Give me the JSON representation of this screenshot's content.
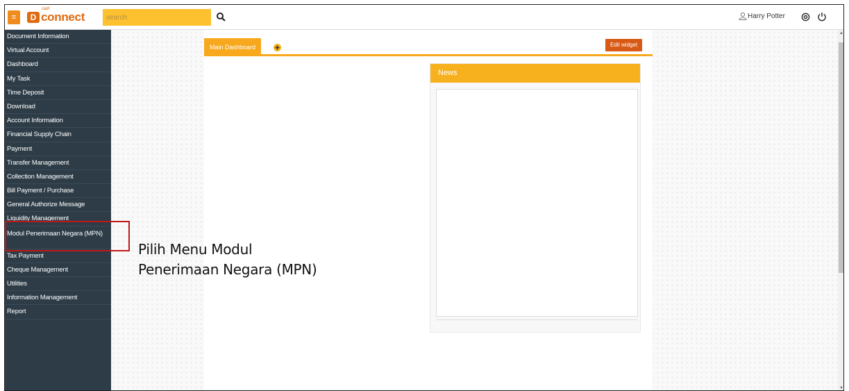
{
  "topbar": {
    "menu_icon": "hamburger-menu-icon",
    "logo": {
      "letter": "D",
      "small": "cash",
      "word": "connect"
    },
    "search_placeholder": "search",
    "search_icon": "search-icon",
    "user_name": "Harry Potter",
    "user_icon": "user-icon",
    "support_icon": "support-icon",
    "power_icon": "power-icon"
  },
  "sidebar": {
    "items": [
      {
        "label": "Document Information"
      },
      {
        "label": "Virtual Account"
      },
      {
        "label": "Dashboard"
      },
      {
        "label": "My Task"
      },
      {
        "label": "Time Deposit"
      },
      {
        "label": "Download"
      },
      {
        "label": "Account Information"
      },
      {
        "label": "Financial Supply Chain"
      },
      {
        "label": "Payment"
      },
      {
        "label": "Transfer Management"
      },
      {
        "label": "Collection Management"
      },
      {
        "label": "Bill Payment / Purchase"
      },
      {
        "label": "General Authorize Message"
      },
      {
        "label": "Liquidity Management"
      },
      {
        "label": "Modul Penerimaan Negara (MPN)"
      },
      {
        "label": "Tax Payment"
      },
      {
        "label": "Cheque Management"
      },
      {
        "label": "Utilities"
      },
      {
        "label": "Information Management"
      },
      {
        "label": "Report"
      }
    ]
  },
  "dashboard": {
    "tab_label": "Main Dashboard",
    "add_tab_icon": "add-tab-icon",
    "edit_widget_label": "Edit widget",
    "news_title": "News"
  },
  "annotation": {
    "line1": "Pilih Menu Modul",
    "line2": "Penerimaan Negara (MPN)"
  },
  "colors": {
    "accent": "#f7a81c",
    "sidebar_bg": "#2d3c47",
    "brand": "#e06a10",
    "highlight": "#c01818"
  }
}
